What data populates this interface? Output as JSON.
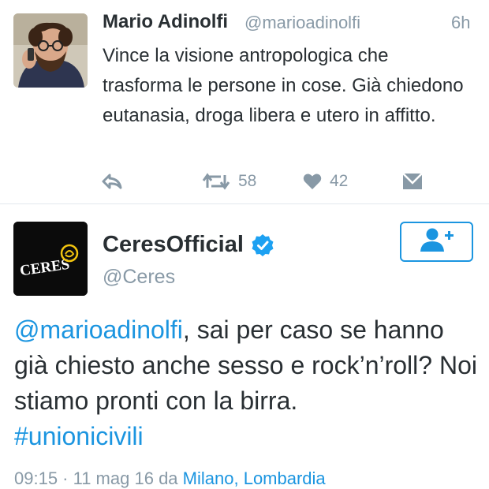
{
  "tweet1": {
    "author_name": "Mario Adinolfi",
    "author_handle": "@marioadinolfi",
    "time": "6h",
    "text": "Vince la visione antropologica che trasforma le persone in cose. Già chiedono eutanasia, droga libera e utero in affitto.",
    "retweets": "58",
    "likes": "42",
    "icons": {
      "reply": "reply-icon",
      "retweet": "retweet-icon",
      "like": "heart-icon",
      "dm": "envelope-icon"
    }
  },
  "tweet2": {
    "author_name": "CeresOfficial",
    "author_handle": "@Ceres",
    "avatar_text": "CERES",
    "text_mention": "@marioadinolfi",
    "text_body": ", sai per caso se hanno già chiesto anche sesso e rock’n’roll? Noi stiamo pronti con la birra.",
    "hashtag": "#unionicivili",
    "timestamp": "09:15 · 11 mag 16",
    "via": "da",
    "location": "Milano, Lombardia"
  },
  "colors": {
    "text": "#292f33",
    "muted": "#8899a6",
    "link": "#1b95e0",
    "divider": "#e1e8ed",
    "ceres_yellow": "#f2c40f"
  }
}
